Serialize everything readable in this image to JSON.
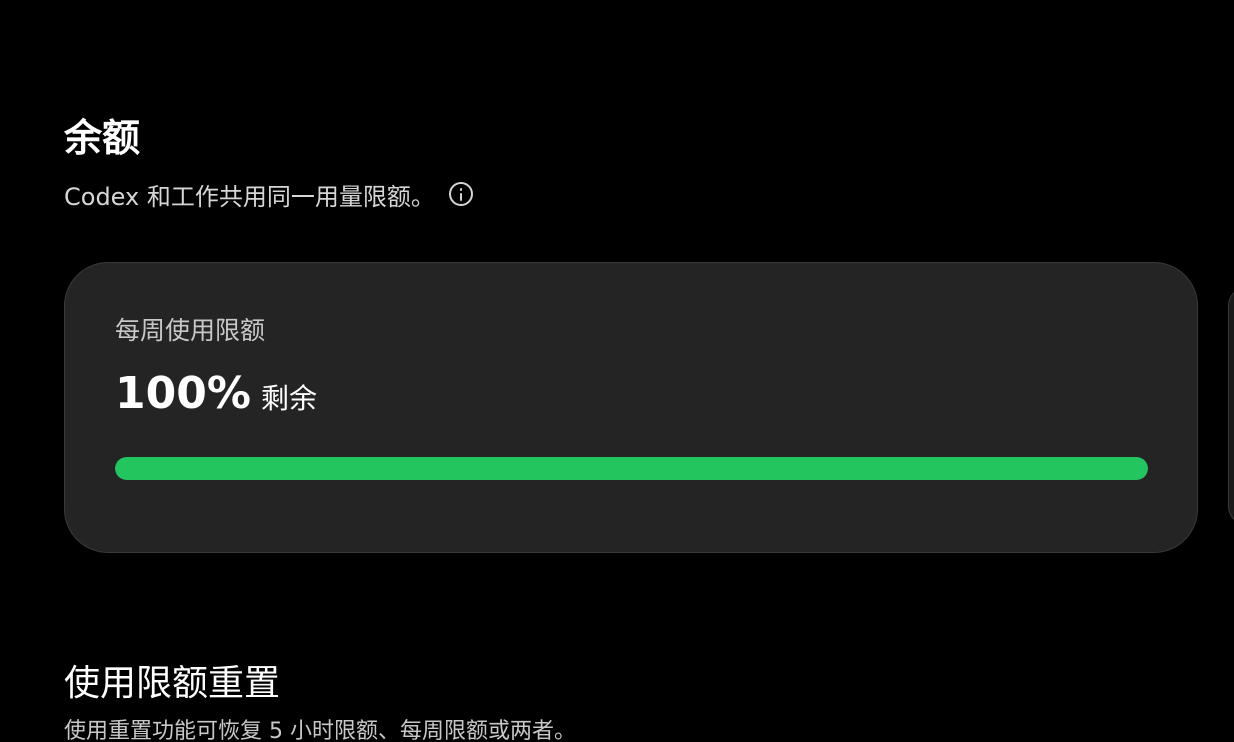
{
  "balance": {
    "title": "余额",
    "subtitle": "Codex 和工作共用同一用量限额。",
    "info_icon": "info-icon"
  },
  "weekly_limit": {
    "label": "每周使用限额",
    "value": "100%",
    "unit": "剩余",
    "progress_fraction": 1.0,
    "progress_color": "#22c55e"
  },
  "reset": {
    "title": "使用限额重置",
    "description": "使用重置功能可恢复 5 小时限额、每周限额或两者。"
  }
}
